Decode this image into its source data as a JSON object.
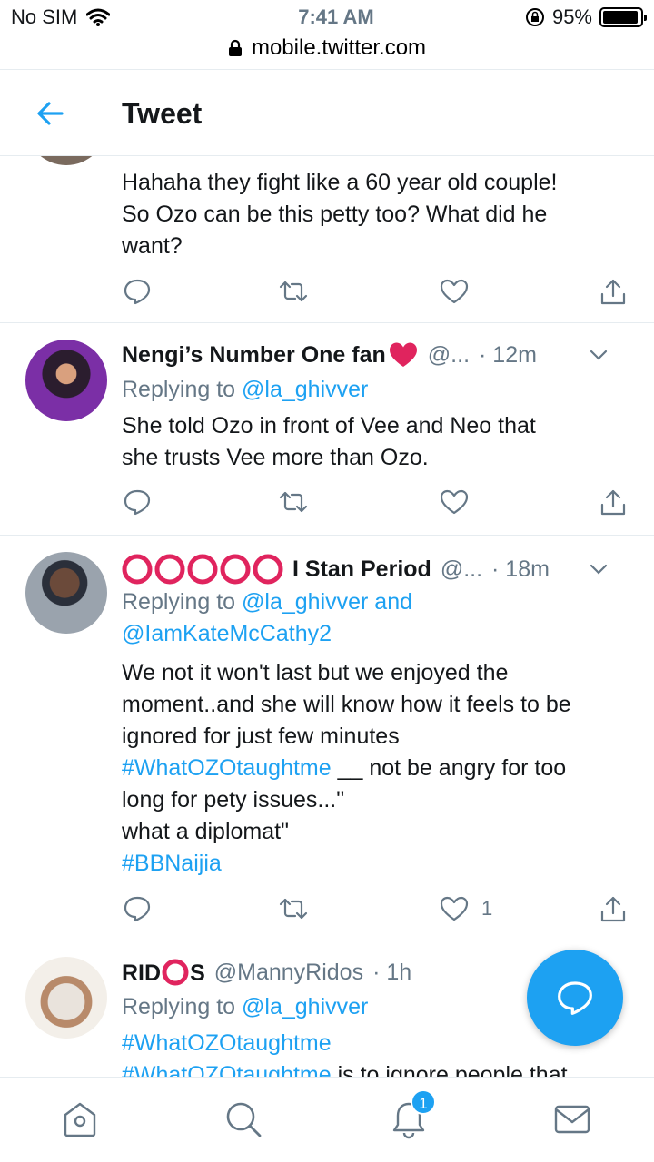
{
  "status_bar": {
    "carrier": "No SIM",
    "time": "7:41 AM",
    "battery_percent": "95%",
    "battery_level": 0.95
  },
  "browser": {
    "url": "mobile.twitter.com"
  },
  "header": {
    "title": "Tweet"
  },
  "tweets": [
    {
      "body_lines": [
        "Hahaha they fight like a 60 year old couple!",
        "So Ozo can be this petty too? What did he",
        "want?"
      ]
    },
    {
      "name": "Nengi’s Number One fan",
      "handle": "@...",
      "time": "· 12m",
      "replying_prefix": "Replying to ",
      "replying_to": "@la_ghivver",
      "body_lines": [
        "She told Ozo in front of Vee and Neo that",
        "she trusts Vee more than Ozo."
      ]
    },
    {
      "name": "I Stan Period",
      "handle": "@...",
      "time": "· 18m",
      "replying_prefix": "Replying to ",
      "replying_to": "@la_ghivver and",
      "replying_to_2": "@IamKateMcCathy2",
      "body_line1": "We not it won't last but we enjoyed the",
      "body_line2": "moment..and she will know how it feels to be",
      "body_line3": "ignored for just few minutes",
      "hashtag1": "#WhatOZOtaughtme",
      "body_line4_rest": " __ not be angry for too",
      "body_line5": "long for pety issues...\"",
      "body_line6": "what a diplomat\"",
      "hashtag2": "#BBNaijia",
      "like_count": "1"
    },
    {
      "name_a": "RID",
      "name_b": "S",
      "handle": "@MannyRidos",
      "time": "· 1h",
      "replying_prefix": "Replying to ",
      "replying_to": "@la_ghivver",
      "hashtag1": "#WhatOZOtaughtme",
      "hashtag2": "#WhatOZOtaughtme",
      "body_rest": " is to ignore people that"
    }
  ],
  "tabbar": {
    "notification_count": "1"
  },
  "colors": {
    "accent": "#1da1f2",
    "muted": "#657786",
    "text": "#14171a",
    "heart": "#e0245e",
    "ring": "#e0245e"
  },
  "icons": [
    "back-arrow-icon",
    "lock-icon",
    "wifi-icon",
    "orientation-lock-icon",
    "reply-icon",
    "retweet-icon",
    "like-icon",
    "share-icon",
    "chevron-down-icon",
    "compose-reply-icon",
    "home-icon",
    "search-icon",
    "bell-icon",
    "mail-icon"
  ]
}
